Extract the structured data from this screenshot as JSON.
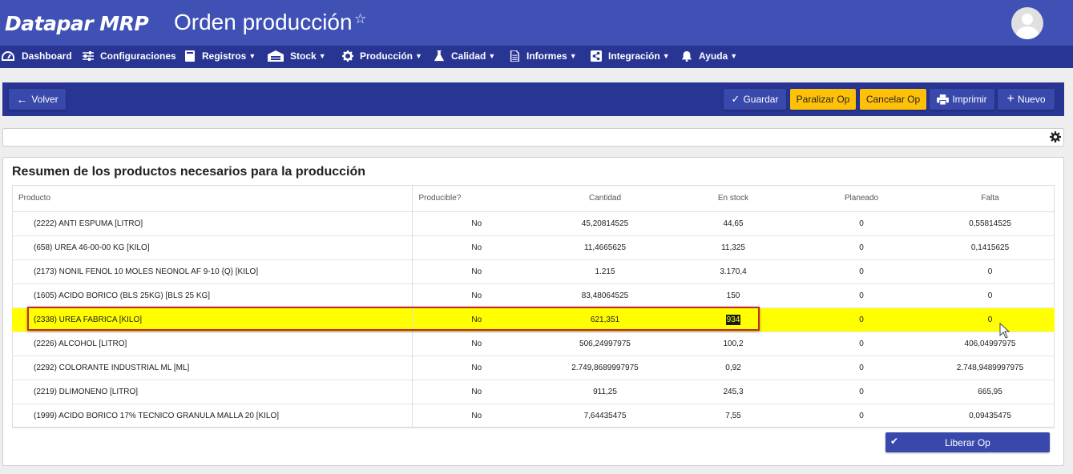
{
  "header": {
    "brand": "Datapar MRP",
    "title": "Orden producción",
    "star_icon": "star-outline-icon"
  },
  "nav": [
    {
      "label": "Dashboard",
      "icon": "dashboard-icon"
    },
    {
      "label": "Configuraciones",
      "icon": "sliders-icon"
    },
    {
      "label": "Registros",
      "icon": "book-icon"
    },
    {
      "label": "Stock",
      "icon": "warehouse-icon"
    },
    {
      "label": "Producción",
      "icon": "gear-icon"
    },
    {
      "label": "Calidad",
      "icon": "flask-icon"
    },
    {
      "label": "Informes",
      "icon": "document-icon"
    },
    {
      "label": "Integración",
      "icon": "share-icon"
    },
    {
      "label": "Ayuda",
      "icon": "bell-icon"
    }
  ],
  "toolbar": {
    "back": "Volver",
    "save": "Guardar",
    "pause": "Paralizar Op",
    "cancel": "Cancelar Op",
    "print": "Imprimir",
    "new": "Nuevo"
  },
  "panel": {
    "title": "Resumen de los productos necesarios para la producción",
    "columns": [
      "Producto",
      "Producible?",
      "Cantidad",
      "En stock",
      "Planeado",
      "Falta"
    ],
    "rows": [
      [
        "(2222) ANTI ESPUMA [LITRO]",
        "No",
        "45,20814525",
        "44,65",
        "0",
        "0,55814525"
      ],
      [
        "(658) UREA 46-00-00 KG [KILO]",
        "No",
        "11,4665625",
        "11,325",
        "0",
        "0,1415625"
      ],
      [
        "(2173) NONIL FENOL 10 MOLES NEONOL AF 9-10 {Q} [KILO]",
        "No",
        "1.215",
        "3.170,4",
        "0",
        "0"
      ],
      [
        "(1605) ACIDO BORICO (BLS 25KG) [BLS 25 KG]",
        "No",
        "83,48064525",
        "150",
        "0",
        "0"
      ],
      [
        "(2338) UREA FABRICA [KILO]",
        "No",
        "621,351",
        "934",
        "0",
        "0"
      ],
      [
        "(2226) ALCOHOL [LITRO]",
        "No",
        "506,24997975",
        "100,2",
        "0",
        "406,04997975"
      ],
      [
        "(2292) COLORANTE INDUSTRIAL ML [ML]",
        "No",
        "2.749,8689997975",
        "0,92",
        "0",
        "2.748,9489997975"
      ],
      [
        "(2219) DLIMONENO [LITRO]",
        "No",
        "911,25",
        "245,3",
        "0",
        "665,95"
      ],
      [
        "(1999) ACIDO BORICO 17% TECNICO GRANULA MALLA 20 [KILO]",
        "No",
        "7,64435475",
        "7,55",
        "0",
        "0,09435475"
      ]
    ],
    "release": "Liberar Op"
  },
  "colors": {
    "header": "#3f51b5",
    "nav": "#283593",
    "button": "#3949ab",
    "warning_button": "#ffc107",
    "highlight": "#ffff00"
  }
}
